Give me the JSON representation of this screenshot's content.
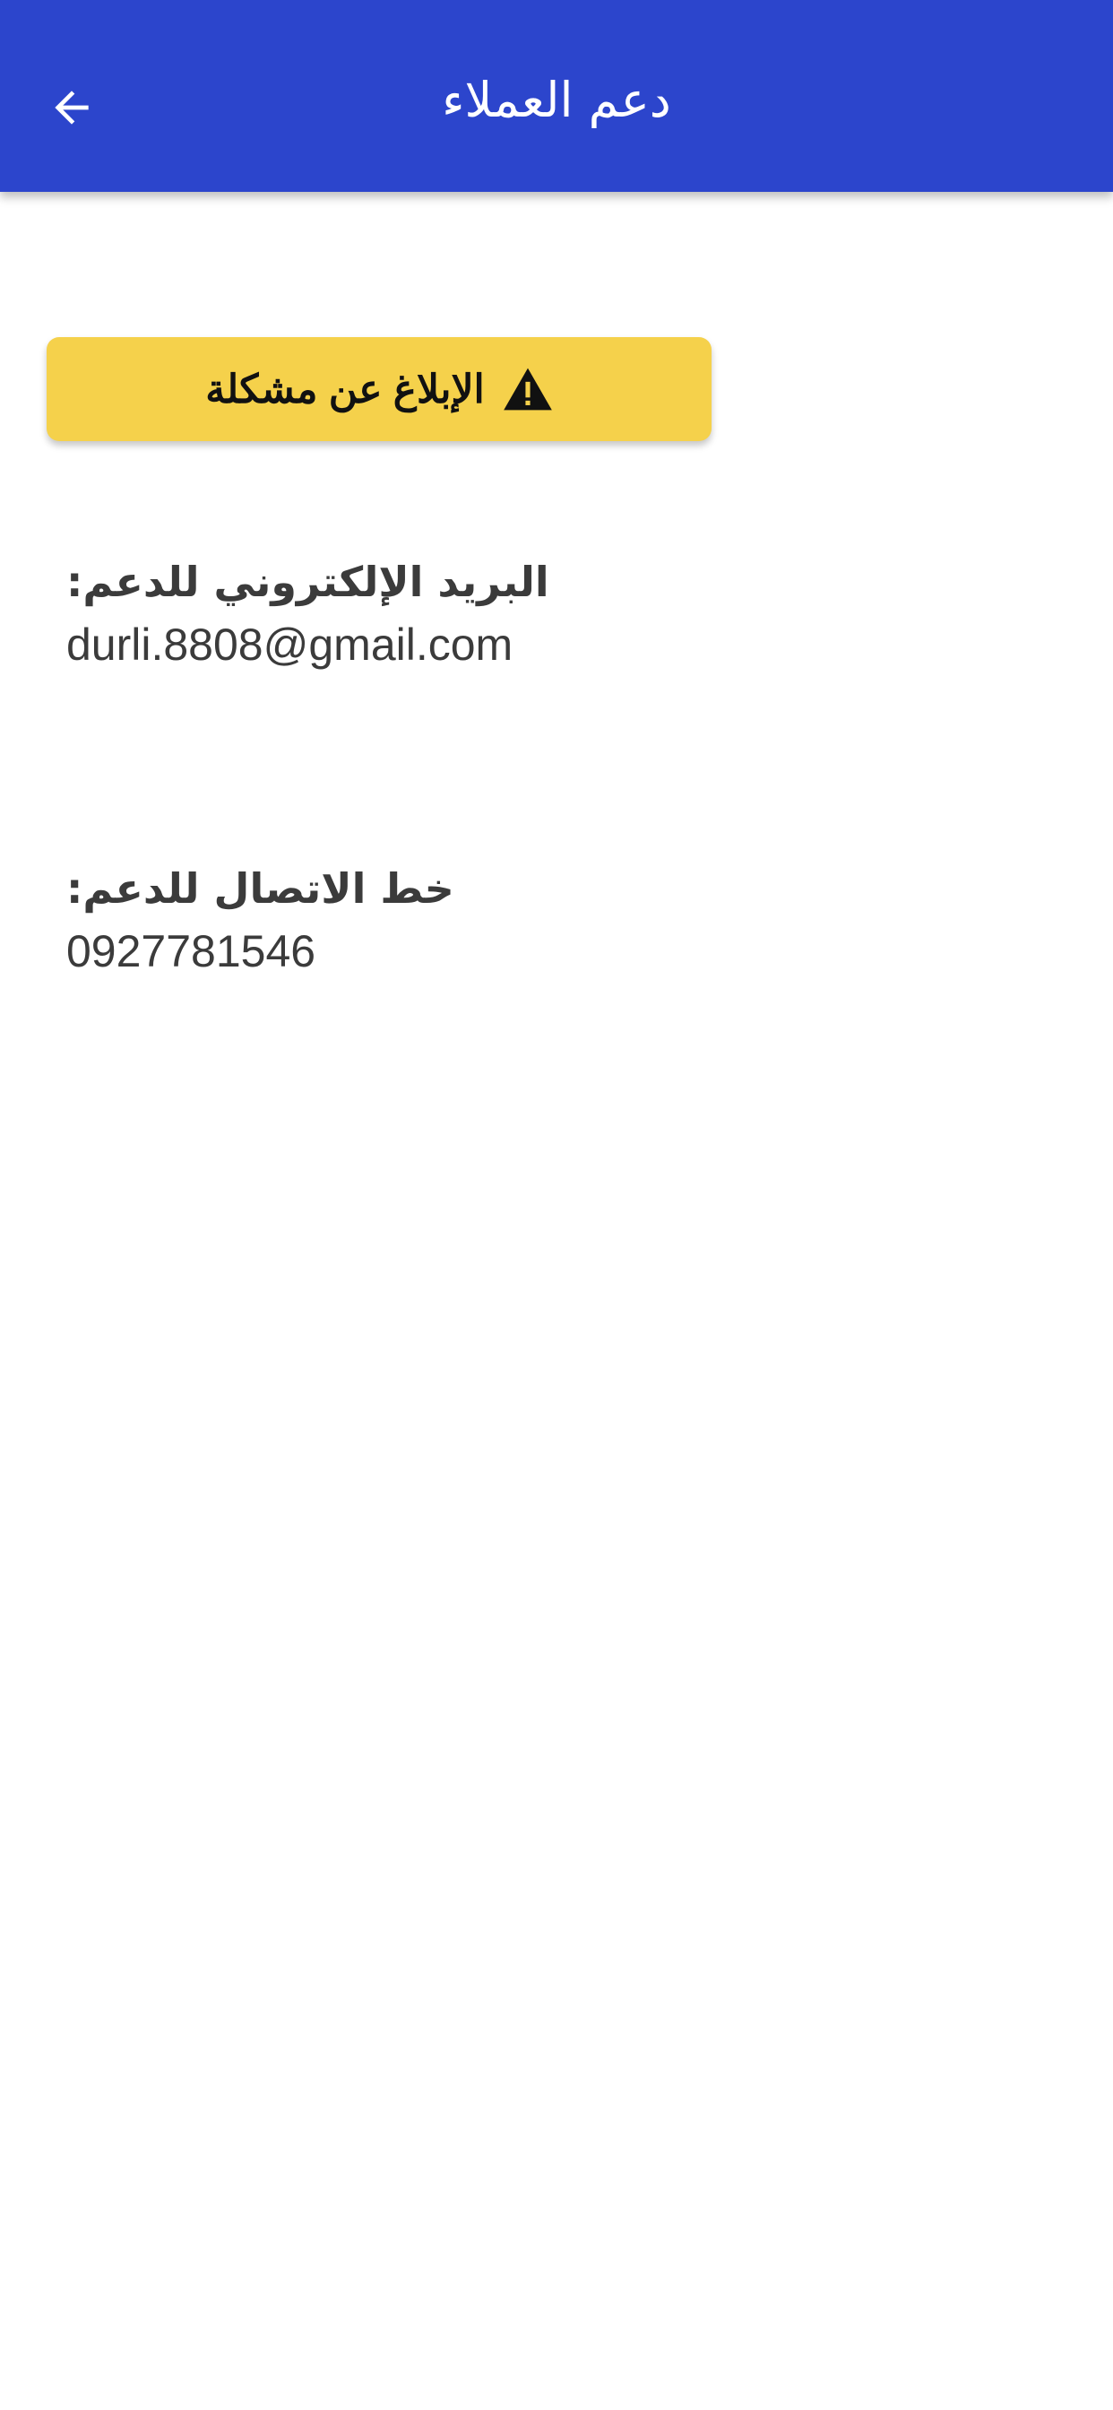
{
  "app_bar": {
    "title": "دعم العملاء",
    "back_icon": "arrow-left-icon",
    "background_color": "#2c45cc"
  },
  "report_button": {
    "label": "الإبلاغ عن مشكلة",
    "icon": "warning-icon",
    "background_color": "#f5d14b"
  },
  "email": {
    "label": "البريد الإلكتروني للدعم:",
    "value": "durli.8808@gmail.com"
  },
  "phone": {
    "label": "خط الاتصال للدعم:",
    "value": "0927781546"
  }
}
